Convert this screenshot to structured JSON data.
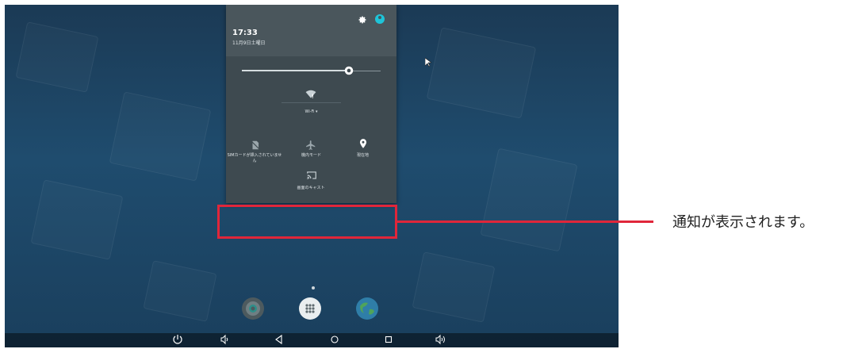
{
  "status": {
    "time": "17:33",
    "date": "11月9日土曜日"
  },
  "quick_settings": {
    "wifi_label": "Wi-Fi ▾",
    "tiles": [
      {
        "label": "SIMカードが挿入されていません",
        "icon": "sim-off-icon"
      },
      {
        "label": "機内モード",
        "icon": "airplane-icon"
      },
      {
        "label": "現在地",
        "icon": "location-icon"
      }
    ],
    "cast_label": "画面のキャスト"
  },
  "annotation": {
    "text": "通知が表示されます。",
    "color": "#e0263a"
  },
  "dock": {
    "icons": [
      "settings-app-icon",
      "app-drawer-icon",
      "browser-app-icon"
    ]
  },
  "nav_bar": {
    "icons": [
      "power-icon",
      "volume-down-icon",
      "back-icon",
      "home-icon",
      "recents-icon",
      "volume-up-icon"
    ]
  }
}
